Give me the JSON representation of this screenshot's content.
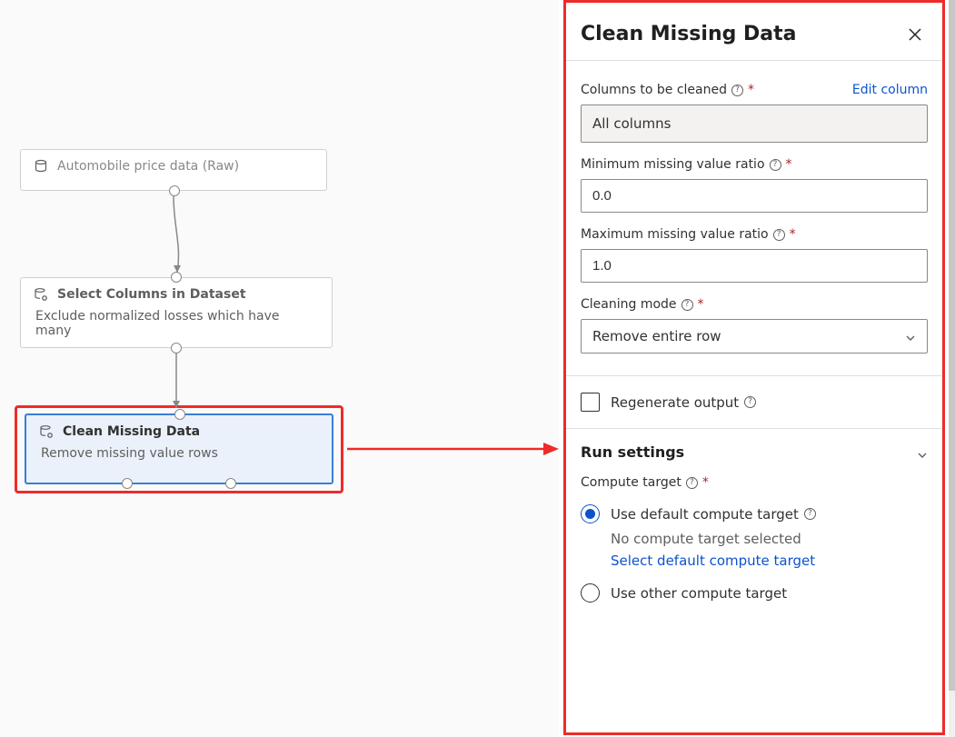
{
  "nodes": {
    "automobile": {
      "title": "Automobile price data (Raw)"
    },
    "select_columns": {
      "title": "Select Columns in Dataset",
      "subtitle": "Exclude normalized losses which have many"
    },
    "clean_missing": {
      "title": "Clean Missing Data",
      "subtitle": "Remove missing value rows"
    }
  },
  "panel": {
    "title": "Clean Missing Data",
    "columns_to_clean": {
      "label": "Columns to be cleaned",
      "edit_link": "Edit column",
      "value": "All columns"
    },
    "min_ratio": {
      "label": "Minimum missing value ratio",
      "value": "0.0"
    },
    "max_ratio": {
      "label": "Maximum missing value ratio",
      "value": "1.0"
    },
    "cleaning_mode": {
      "label": "Cleaning mode",
      "value": "Remove entire row"
    },
    "regenerate": {
      "label": "Regenerate output"
    },
    "run_settings": {
      "heading": "Run settings",
      "compute_target_label": "Compute target",
      "use_default_label": "Use default compute target",
      "no_target_text": "No compute target selected",
      "select_link": "Select default compute target",
      "use_other_label": "Use other compute target"
    }
  }
}
